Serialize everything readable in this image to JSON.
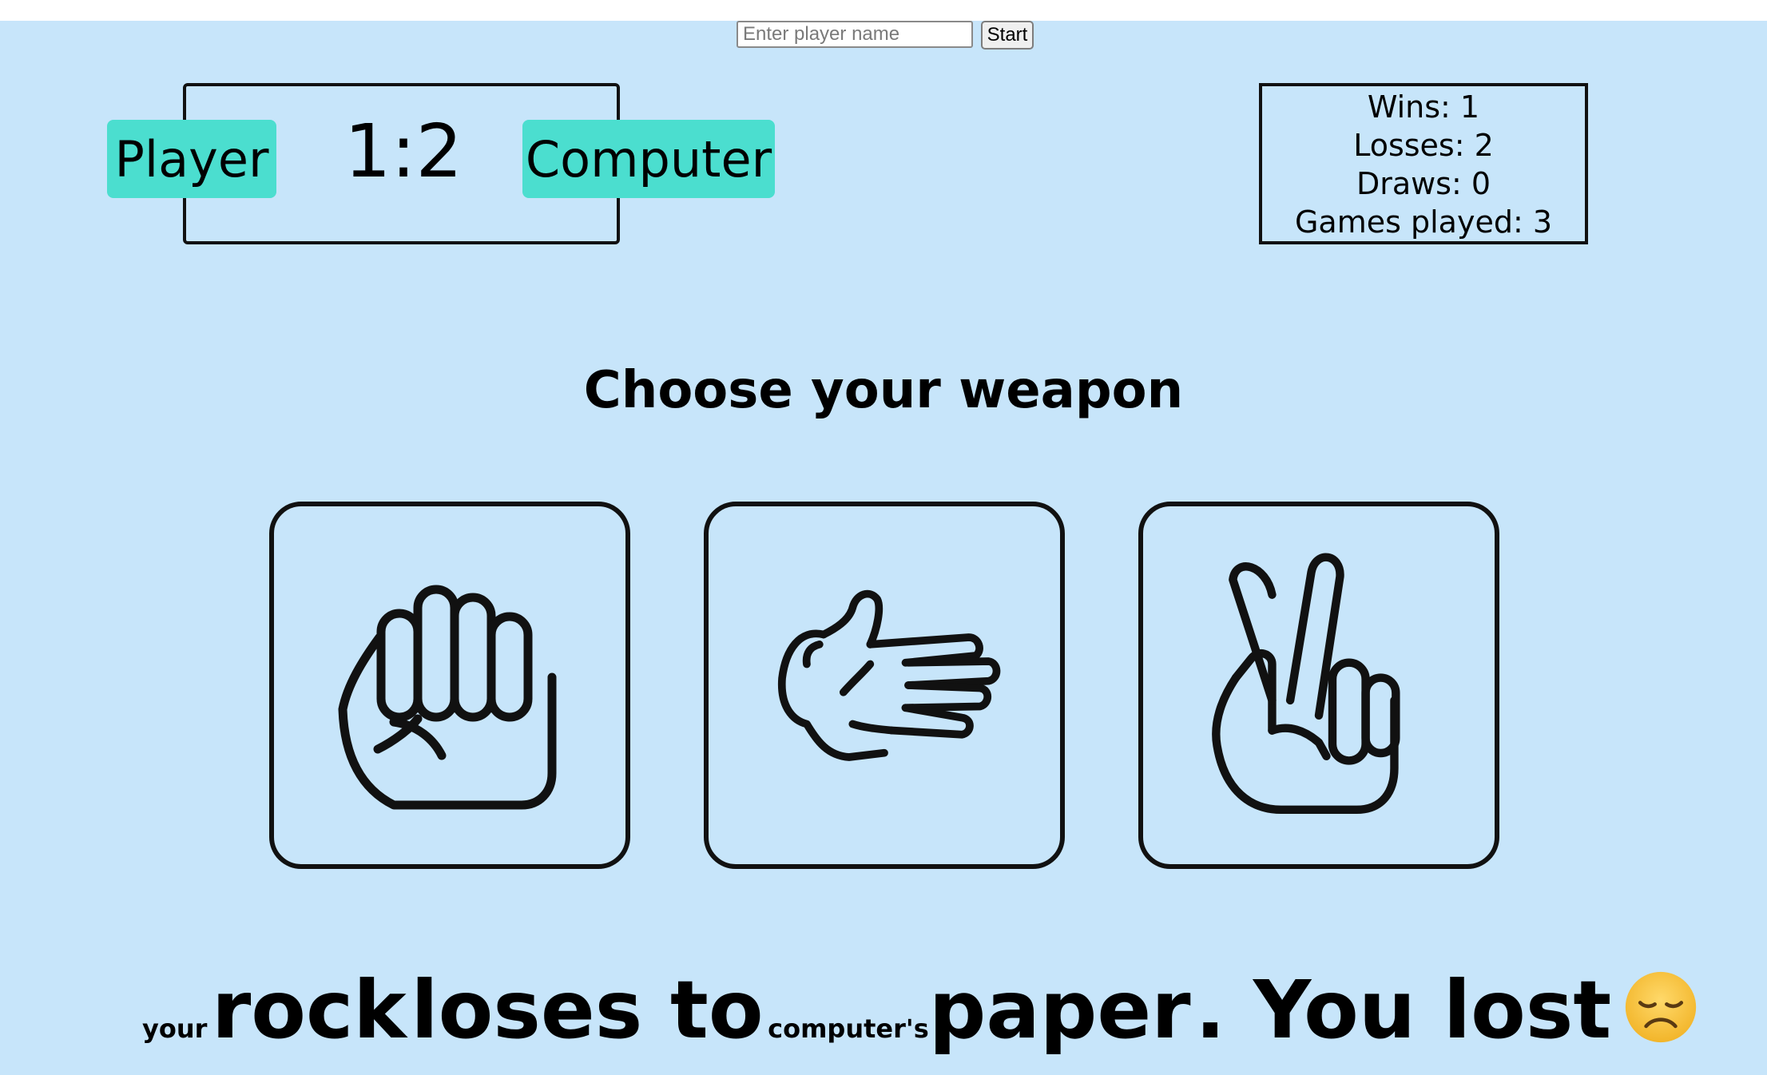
{
  "header": {
    "name_placeholder": "Enter player name",
    "start_label": "Start"
  },
  "scoreboard": {
    "player_label": "Player",
    "computer_label": "Computer",
    "score": "1:2"
  },
  "stats": {
    "wins": "Wins: 1",
    "losses": "Losses: 2",
    "draws": "Draws: 0",
    "games_played": "Games played: 3"
  },
  "main": {
    "heading": "Choose your weapon",
    "weapons": [
      {
        "icon": "rock-hand-icon"
      },
      {
        "icon": "paper-hand-icon"
      },
      {
        "icon": "scissors-hand-icon"
      }
    ]
  },
  "result": {
    "your_prefix": "your",
    "player_choice": "rock",
    "verb": "loses to",
    "computer_prefix": "computer's",
    "computer_choice": "paper",
    "outcome": ". You lost",
    "emoji_icon": "disappointed-face-icon"
  },
  "colors": {
    "background": "#c7e5fa",
    "tag": "#4bdecf",
    "emoji": "#f7c33a"
  }
}
